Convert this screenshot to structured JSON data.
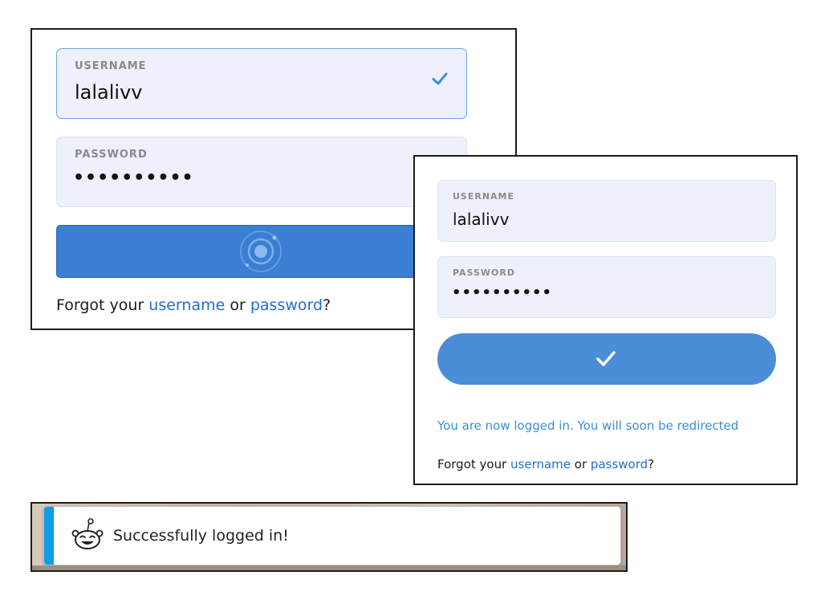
{
  "colors": {
    "accent": "#3a7fd3",
    "field_bg": "#eef1fc",
    "link": "#1f6fd0",
    "success_text": "#3b8ed6",
    "toast_bar": "#0d9ee3"
  },
  "panel1": {
    "username_label": "USERNAME",
    "username_value": "lalalivv",
    "username_status_icon": "checkmark-icon",
    "password_label": "PASSWORD",
    "password_value": "••••••••••",
    "button_icon": "loading-spinner-icon",
    "forgot": {
      "prefix": "Forgot your ",
      "username_link": "username",
      "middle": " or ",
      "password_link": "password",
      "suffix": "?"
    }
  },
  "panel2": {
    "username_label": "USERNAME",
    "username_value": "lalalivv",
    "password_label": "PASSWORD",
    "password_value": "••••••••••",
    "button_icon": "checkmark-icon",
    "status_message": "You are now logged in. You will soon be redirected",
    "forgot": {
      "prefix": "Forgot your ",
      "username_link": "username",
      "middle": " or ",
      "password_link": "password",
      "suffix": "?"
    }
  },
  "toast": {
    "icon": "snoo-icon",
    "message": "Successfully logged in!"
  }
}
